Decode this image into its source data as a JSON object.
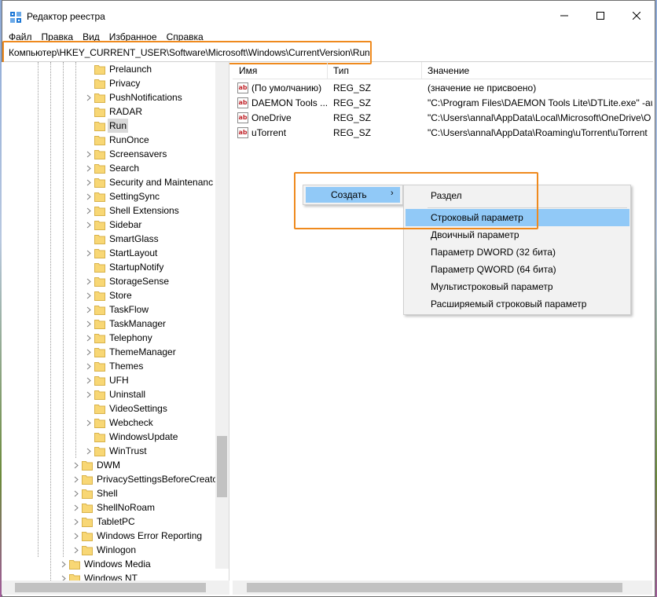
{
  "window": {
    "title": "Редактор реестра"
  },
  "menu": [
    "Файл",
    "Правка",
    "Вид",
    "Избранное",
    "Справка"
  ],
  "address": "Компьютер\\HKEY_CURRENT_USER\\Software\\Microsoft\\Windows\\CurrentVersion\\Run",
  "tree": {
    "items": [
      {
        "label": "Prelaunch",
        "expandable": false
      },
      {
        "label": "Privacy",
        "expandable": false
      },
      {
        "label": "PushNotifications",
        "expandable": true
      },
      {
        "label": "RADAR",
        "expandable": false
      },
      {
        "label": "Run",
        "expandable": false,
        "selected": true
      },
      {
        "label": "RunOnce",
        "expandable": false
      },
      {
        "label": "Screensavers",
        "expandable": true
      },
      {
        "label": "Search",
        "expandable": true
      },
      {
        "label": "Security and Maintenanc",
        "expandable": true
      },
      {
        "label": "SettingSync",
        "expandable": true
      },
      {
        "label": "Shell Extensions",
        "expandable": true
      },
      {
        "label": "Sidebar",
        "expandable": true
      },
      {
        "label": "SmartGlass",
        "expandable": false
      },
      {
        "label": "StartLayout",
        "expandable": true
      },
      {
        "label": "StartupNotify",
        "expandable": false
      },
      {
        "label": "StorageSense",
        "expandable": true
      },
      {
        "label": "Store",
        "expandable": true
      },
      {
        "label": "TaskFlow",
        "expandable": true
      },
      {
        "label": "TaskManager",
        "expandable": true
      },
      {
        "label": "Telephony",
        "expandable": true
      },
      {
        "label": "ThemeManager",
        "expandable": true
      },
      {
        "label": "Themes",
        "expandable": true
      },
      {
        "label": "UFH",
        "expandable": true
      },
      {
        "label": "Uninstall",
        "expandable": true
      },
      {
        "label": "VideoSettings",
        "expandable": false
      },
      {
        "label": "Webcheck",
        "expandable": true
      },
      {
        "label": "WindowsUpdate",
        "expandable": false
      },
      {
        "label": "WinTrust",
        "expandable": true
      },
      {
        "label": "DWM",
        "expandable": true
      },
      {
        "label": "PrivacySettingsBeforeCreato",
        "expandable": true
      },
      {
        "label": "Shell",
        "expandable": true
      },
      {
        "label": "ShellNoRoam",
        "expandable": true
      },
      {
        "label": "TabletPC",
        "expandable": true
      },
      {
        "label": "Windows Error Reporting",
        "expandable": true
      },
      {
        "label": "Winlogon",
        "expandable": true
      },
      {
        "label": "Windows Media",
        "expandable": true
      },
      {
        "label": "Windows NT",
        "expandable": true
      }
    ]
  },
  "list": {
    "headers": {
      "name": "Имя",
      "type": "Тип",
      "value": "Значение"
    },
    "rows": [
      {
        "name": "(По умолчанию)",
        "type": "REG_SZ",
        "value": "(значение не присвоено)"
      },
      {
        "name": "DAEMON Tools ...",
        "type": "REG_SZ",
        "value": "\"C:\\Program Files\\DAEMON Tools Lite\\DTLite.exe\" -au"
      },
      {
        "name": "OneDrive",
        "type": "REG_SZ",
        "value": "\"C:\\Users\\annal\\AppData\\Local\\Microsoft\\OneDrive\\O"
      },
      {
        "name": "uTorrent",
        "type": "REG_SZ",
        "value": "\"C:\\Users\\annal\\AppData\\Roaming\\uTorrent\\uTorrent"
      }
    ]
  },
  "context_menu": {
    "create_label": "Создать",
    "create_arrow": "›",
    "submenu": [
      "Раздел",
      "Строковый параметр",
      "Двоичный параметр",
      "Параметр DWORD (32 бита)",
      "Параметр QWORD (64 бита)",
      "Мультистроковый параметр",
      "Расширяемый строковый параметр"
    ],
    "highlighted_index": 1
  },
  "colors": {
    "highlight": "#91c9f7",
    "annotation": "#ef8a1e",
    "folder": "#f8d775"
  }
}
